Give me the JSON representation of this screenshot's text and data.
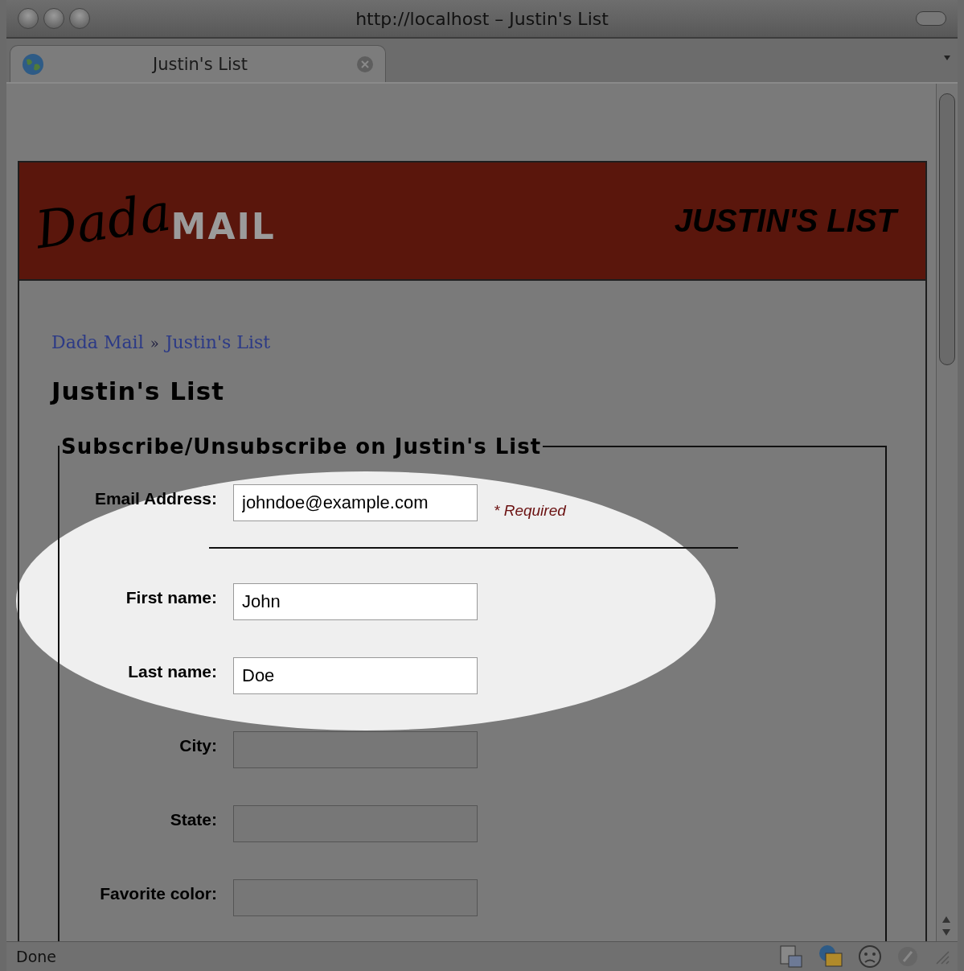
{
  "window": {
    "title": "http://localhost – Justin's List"
  },
  "tabs": [
    {
      "label": "Justin's List",
      "selected": true
    }
  ],
  "banner": {
    "logo_script": "Dada",
    "logo_word": "MAIL",
    "list_name": "JUSTIN'S LIST"
  },
  "breadcrumb": [
    {
      "label": "Dada Mail"
    },
    {
      "label": "Justin's List"
    }
  ],
  "breadcrumb_separator": "»",
  "heading": "Justin's List",
  "form": {
    "legend": "Subscribe/Unsubscribe on Justin's List",
    "fields": [
      {
        "label": "Email Address:",
        "value": "johndoe@example.com",
        "required_note": "* Required",
        "highlighted": true
      },
      {
        "label": "First name:",
        "value": "John",
        "highlighted": true
      },
      {
        "label": "Last name:",
        "value": "Doe",
        "highlighted": true
      },
      {
        "label": "City:",
        "highlighted": false
      },
      {
        "label": "State:",
        "highlighted": false
      },
      {
        "label": "Favorite color:",
        "highlighted": false
      }
    ]
  },
  "status_bar": {
    "text": "Done"
  }
}
